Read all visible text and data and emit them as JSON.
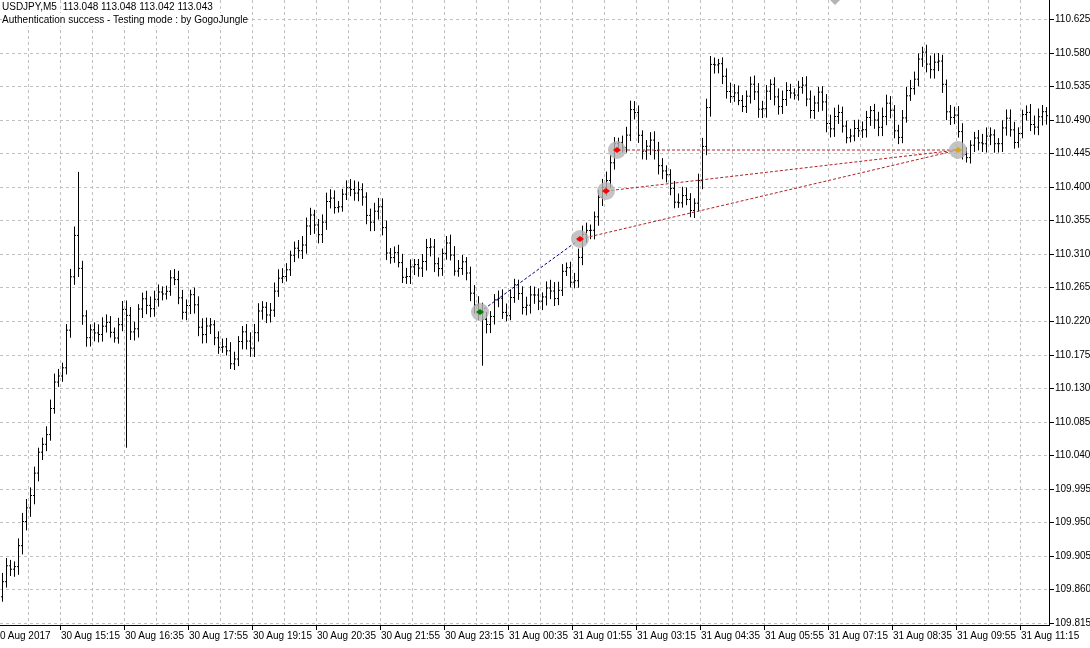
{
  "header": {
    "symbol": "USDJPY,M5",
    "quote": "113.048 113.048 113.042 113.043",
    "status": "Authentication success - Testing mode : by GogoJungle"
  },
  "price_axis": {
    "labels": [
      "110.625",
      "110.580",
      "110.535",
      "110.490",
      "110.445",
      "110.400",
      "110.355",
      "110.310",
      "110.265",
      "110.220",
      "110.175",
      "110.130",
      "110.085",
      "110.040",
      "109.995",
      "109.950",
      "109.905",
      "109.860",
      "109.815"
    ]
  },
  "time_axis": {
    "labels": [
      "0 Aug 2017",
      "30 Aug 15:15",
      "30 Aug 16:35",
      "30 Aug 17:55",
      "30 Aug 19:15",
      "30 Aug 20:35",
      "30 Aug 21:55",
      "30 Aug 23:15",
      "31 Aug 00:35",
      "31 Aug 01:55",
      "31 Aug 03:15",
      "31 Aug 04:35",
      "31 Aug 05:55",
      "31 Aug 07:15",
      "31 Aug 08:35",
      "31 Aug 09:55",
      "31 Aug 11:15"
    ]
  }
}
